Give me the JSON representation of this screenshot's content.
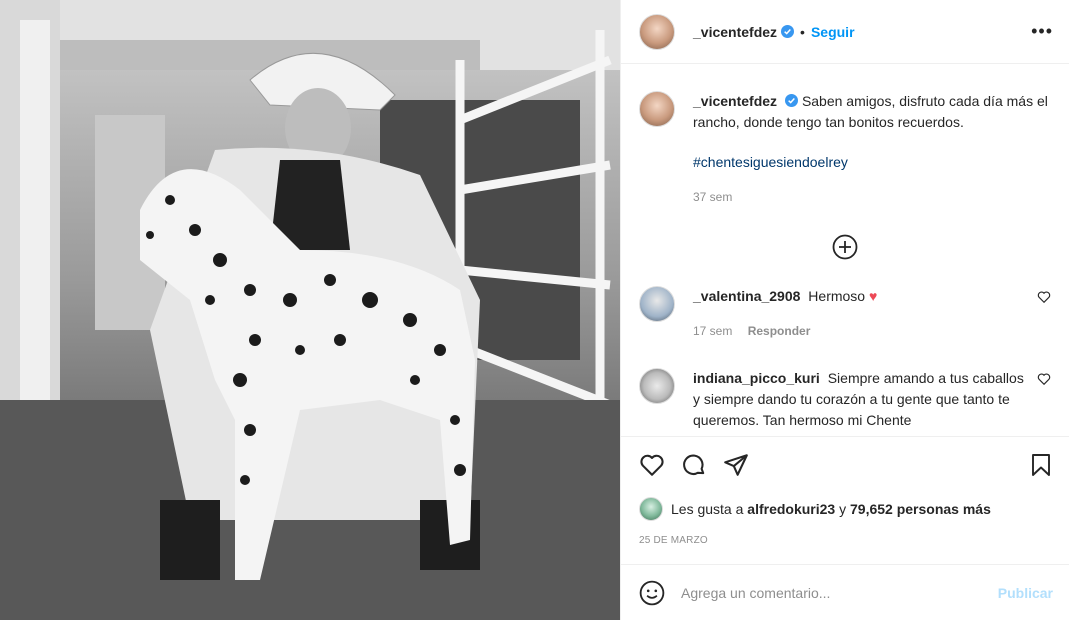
{
  "post": {
    "username": "_vicentefdez",
    "follow_label": "Seguir",
    "separator": "•",
    "more_label": "•••",
    "caption": "Saben amigos, disfruto cada día más el rancho, donde tengo tan bonitos recuerdos.",
    "hashtag": "#chentesiguesiendoelrey",
    "caption_time": "37 sem"
  },
  "comments": [
    {
      "username": "_valentina_2908",
      "text": "Hermoso",
      "time": "17 sem",
      "reply_label": "Responder"
    },
    {
      "username": "indiana_picco_kuri",
      "text": "Siempre amando a tus caballos y siempre dando tu corazón a tu gente que tanto te queremos. Tan hermoso mi Chente"
    }
  ],
  "likes": {
    "prefix": "Les gusta a",
    "user": "alfredokuri23",
    "conj": "y",
    "others": "79,652 personas más"
  },
  "date": "25 DE MARZO",
  "add_comment": {
    "placeholder": "Agrega un comentario...",
    "publish_label": "Publicar"
  },
  "colors": {
    "accent": "#0095f6",
    "heart": "#ed4956",
    "hashtag": "#00376b"
  },
  "icons": [
    "verified-icon",
    "more-icon",
    "add-circle-icon",
    "heart-icon",
    "comment-icon",
    "share-icon",
    "bookmark-icon",
    "emoji-icon"
  ]
}
